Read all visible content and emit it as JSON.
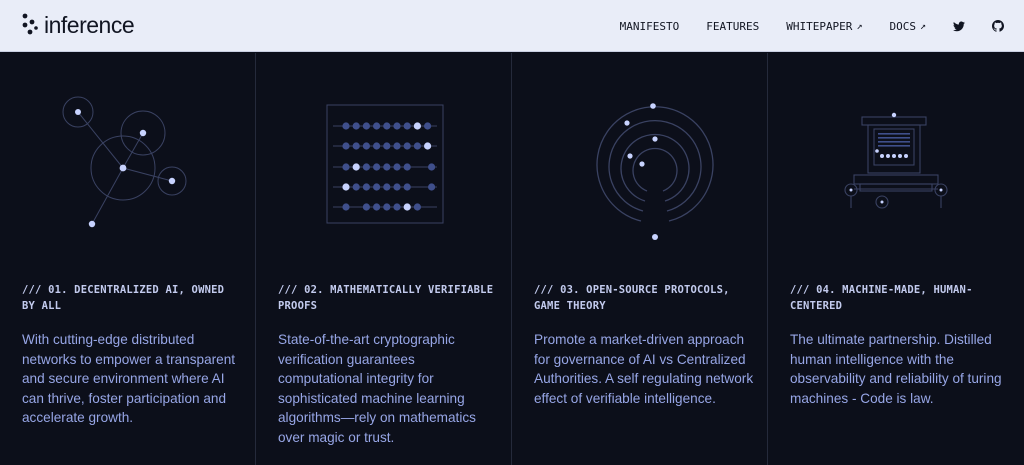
{
  "brand": {
    "name": "inference"
  },
  "nav": {
    "items": [
      {
        "label": "MANIFESTO",
        "external": false
      },
      {
        "label": "FEATURES",
        "external": false
      },
      {
        "label": "WHITEPAPER",
        "external": true
      },
      {
        "label": "DOCS",
        "external": true
      }
    ],
    "external_arrow": "↗",
    "icons": [
      "twitter-icon",
      "github-icon"
    ]
  },
  "features": [
    {
      "heading": "/// 01. DECENTRALIZED AI, OWNED BY ALL",
      "body": "With cutting-edge distributed networks to empower a transparent and secure environment where AI can thrive, foster participation and accelerate growth.",
      "illustration": "network-nodes-illustration"
    },
    {
      "heading": "/// 02. MATHEMATICALLY VERIFIABLE PROOFS",
      "body": "State-of-the-art cryptographic verification guarantees computational integrity for sophisticated machine learning algorithms—rely on mathematics over magic or trust.",
      "illustration": "abacus-illustration"
    },
    {
      "heading": "/// 03. OPEN-SOURCE PROTOCOLS, GAME THEORY",
      "body": "Promote a market-driven approach for governance of AI vs Centralized Authorities. A self regulating network effect of verifiable intelligence.",
      "illustration": "radar-illustration"
    },
    {
      "heading": "/// 04. MACHINE-MADE, HUMAN-CENTERED",
      "body": "The ultimate partnership. Distilled human intelligence with the observability and reliability of turing machines - Code is law.",
      "illustration": "turing-machine-illustration"
    }
  ],
  "colors": {
    "background": "#0c0f1a",
    "header_bg": "#e9edf8",
    "line": "#3a4262",
    "dot": "#c8d3ff",
    "dim_dot": "#3f4f8c",
    "body_text": "#97a6e6"
  }
}
